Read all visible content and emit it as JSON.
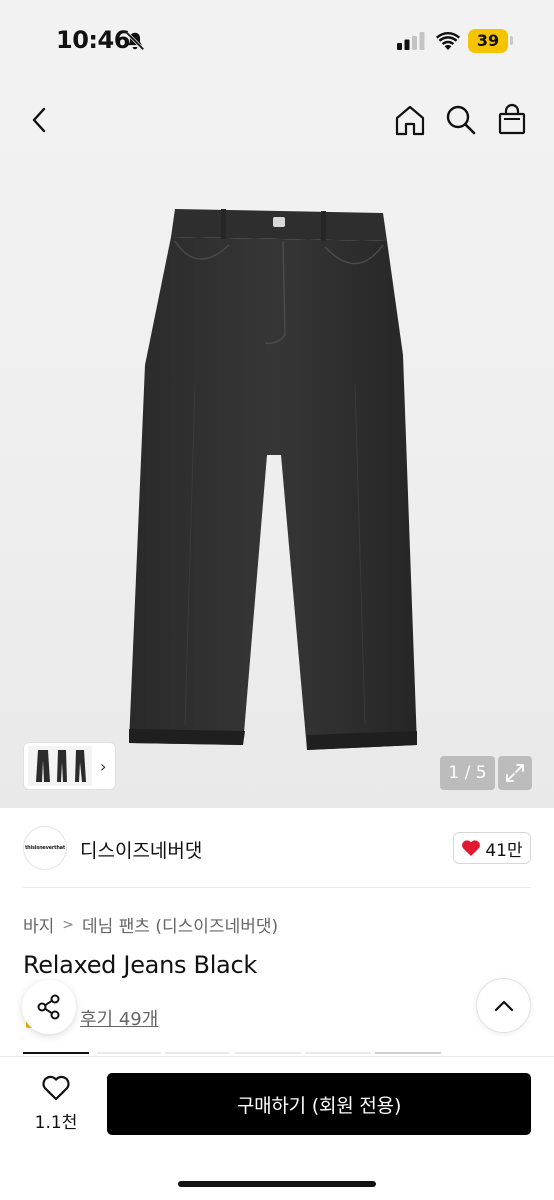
{
  "status_bar": {
    "time": "10:46",
    "battery": "39",
    "icons": [
      "bell-slash-icon",
      "signal-icon",
      "wifi-icon",
      "battery-icon"
    ],
    "battery_color": "#f5c400"
  },
  "nav": {
    "icons": [
      "chevron-left-icon",
      "home-icon",
      "search-icon",
      "shopping-bag-icon"
    ]
  },
  "gallery": {
    "counter": "1 / 5",
    "thumb_chevron": "›",
    "icons": [
      "expand-icon"
    ]
  },
  "brand": {
    "logo_text": "thisisneverthat",
    "name": "디스이즈네버댓",
    "likes": "41만",
    "like_color": "#e1182f"
  },
  "breadcrumb": {
    "items": [
      "바지",
      "데님 팬츠 (디스이즈네버댓)"
    ],
    "separator": ">"
  },
  "product": {
    "title": "Relaxed Jeans Black",
    "reviews": "후기 49개"
  },
  "bottom_bar": {
    "wish_count": "1.1천",
    "buy_label": "구매하기 (회원 전용)",
    "buy_color": "#000000"
  }
}
